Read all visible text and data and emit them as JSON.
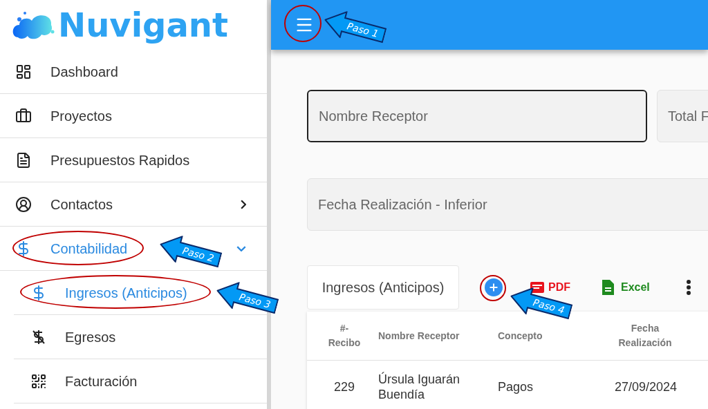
{
  "sidebar": {
    "logo": "Nuvigant",
    "items": [
      {
        "label": "Dashboard",
        "selected": false
      },
      {
        "label": "Proyectos",
        "selected": false
      },
      {
        "label": "Presupuestos Rapidos",
        "selected": false
      },
      {
        "label": "Contactos",
        "selected": false,
        "expanded": false
      },
      {
        "label": "Contabilidad",
        "selected": false,
        "expanded": true,
        "children": [
          {
            "label": "Ingresos (Anticipos)",
            "selected": true
          },
          {
            "label": "Egresos",
            "selected": false
          },
          {
            "label": "Facturación",
            "selected": false
          }
        ]
      }
    ]
  },
  "filters": [
    {
      "placeholder": "Nombre Receptor",
      "focused": true
    },
    {
      "placeholder": "Total F",
      "focused": false
    },
    {
      "placeholder": "Fecha Realización - Inferior",
      "focused": false
    }
  ],
  "toolbar": {
    "title": "Ingresos (Anticipos)",
    "actions": [
      {
        "kind": "add"
      },
      {
        "kind": "pdf",
        "label": "PDF"
      },
      {
        "kind": "excel",
        "label": "Excel"
      },
      {
        "kind": "more"
      }
    ]
  },
  "table": {
    "columns": [
      "#- Recibo",
      "Nombre Receptor",
      "Concepto",
      "Fecha Realización"
    ],
    "rows": [
      [
        "229",
        "Úrsula Iguarán Buendía",
        "Pagos",
        "27/09/2024"
      ]
    ]
  },
  "annotations": [
    {
      "label": "Paso 1"
    },
    {
      "label": "Paso 2"
    },
    {
      "label": "Paso 3"
    },
    {
      "label": "Paso 4"
    }
  ]
}
